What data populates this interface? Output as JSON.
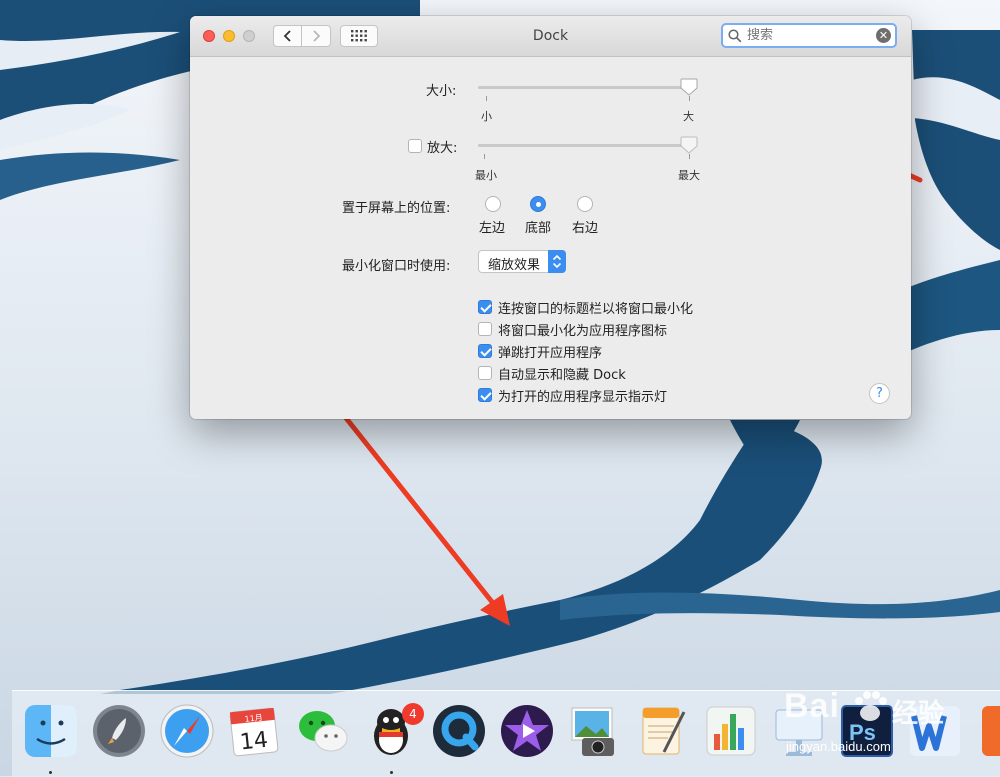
{
  "window": {
    "title": "Dock",
    "search_placeholder": "搜索"
  },
  "size": {
    "label": "大小:",
    "min_label": "小",
    "max_label": "大",
    "value": 1.0
  },
  "magnification": {
    "label": "放大:",
    "checked": false,
    "min_label": "最小",
    "max_label": "最大",
    "value": 1.0
  },
  "position": {
    "label": "置于屏幕上的位置:",
    "options": [
      "左边",
      "底部",
      "右边"
    ],
    "selected": "底部"
  },
  "minimize": {
    "label": "最小化窗口时使用:",
    "value": "缩放效果"
  },
  "options": [
    {
      "label": "连按窗口的标题栏以将窗口最小化",
      "checked": true
    },
    {
      "label": "将窗口最小化为应用程序图标",
      "checked": false
    },
    {
      "label": "弹跳打开应用程序",
      "checked": true
    },
    {
      "label": "自动显示和隐藏 Dock",
      "checked": false
    },
    {
      "label": "为打开的应用程序显示指示灯",
      "checked": true
    }
  ],
  "help": "?",
  "dock": {
    "calendar_month": "11月",
    "calendar_day": "14",
    "qq_badge": "4",
    "ps_label": "Ps"
  },
  "watermark": {
    "brand": "Bai",
    "cn": "经验",
    "url": "jingyan.baidu.com"
  },
  "colors": {
    "accent": "#3b8df0",
    "arrow": "#ee3b24",
    "close": "#fc5f57",
    "minimize": "#fdbb2e"
  }
}
